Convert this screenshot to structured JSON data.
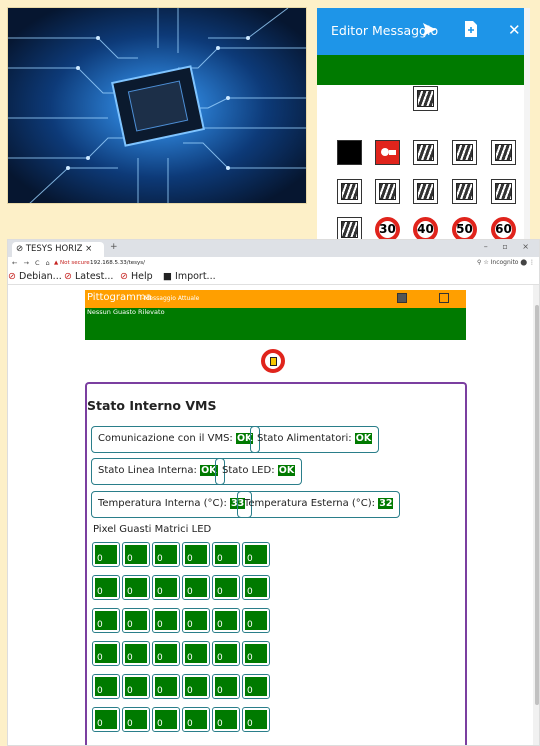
{
  "editor": {
    "title": "Editor Messaggio",
    "close_label": "✕"
  },
  "browser": {
    "tab_title": "TESYS HORIZ",
    "new_tab_label": "+",
    "window_controls": "– ▫ ×",
    "nav_buttons": "← → C ⌂",
    "not_secure": "▲ Not secure",
    "url": "192.168.5.33/tesys/",
    "url_right": "⚲ ☆ Incognito ⬤ ⋮",
    "bookmarks": [
      "Debian...",
      "Latest...",
      "Help",
      "Import..."
    ]
  },
  "pictogram": {
    "title": "Pittogramma",
    "subtitle": "-Messaggio Attuale",
    "status_text": "Nessun Guasto Rilevato"
  },
  "vms": {
    "title": "Stato Interno VMS",
    "rows": [
      [
        {
          "label": "Comunicazione con il VMS:",
          "value": "OK"
        },
        {
          "label": "Stato Alimentatori:",
          "value": "OK"
        }
      ],
      [
        {
          "label": "Stato Linea Interna:",
          "value": "OK"
        },
        {
          "label": "Stato LED:",
          "value": "OK"
        }
      ],
      [
        {
          "label": "Temperatura Interna (°C):",
          "value": "33"
        },
        {
          "label": "Temperatura Esterna (°C):",
          "value": "32"
        }
      ]
    ],
    "led_title": "Pixel Guasti Matrici LED",
    "matrix_values": [
      [
        "0",
        "0",
        "0",
        "0",
        "0",
        "0"
      ],
      [
        "0",
        "0",
        "0",
        "0",
        "0",
        "0"
      ],
      [
        "0",
        "0",
        "0",
        "0",
        "0",
        "0"
      ],
      [
        "0",
        "0",
        "0",
        "0",
        "0",
        "0"
      ],
      [
        "0",
        "0",
        "0",
        "0",
        "0",
        "0"
      ],
      [
        "0",
        "0",
        "0",
        "0",
        "0",
        "0"
      ]
    ]
  },
  "speed_limits": [
    "30",
    "40",
    "50",
    "60"
  ],
  "colors": {
    "editor_header": "#1e95e8",
    "green": "#007a00",
    "orange": "#ff9f00",
    "purple_border": "#7b3fa0",
    "background": "#fdf0c8"
  }
}
